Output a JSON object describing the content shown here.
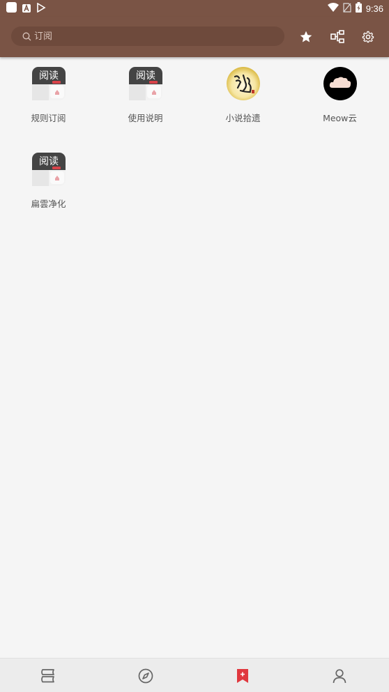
{
  "status_bar": {
    "time": "9:36"
  },
  "toolbar": {
    "search_placeholder": "订阅"
  },
  "tiles": [
    {
      "label": "规则订阅",
      "icon": "yuedu-app-icon",
      "icon_text": "阅读"
    },
    {
      "label": "使用说明",
      "icon": "yuedu-app-icon",
      "icon_text": "阅读"
    },
    {
      "label": "小说拾遗",
      "icon": "calligraphy-icon"
    },
    {
      "label": "Meow云",
      "icon": "cloud-icon"
    },
    {
      "label": "扁雲净化",
      "icon": "yuedu-app-icon",
      "icon_text": "阅读"
    }
  ],
  "colors": {
    "primary": "#7a5445",
    "accent": "#e0383e",
    "background": "#f5f5f5"
  }
}
